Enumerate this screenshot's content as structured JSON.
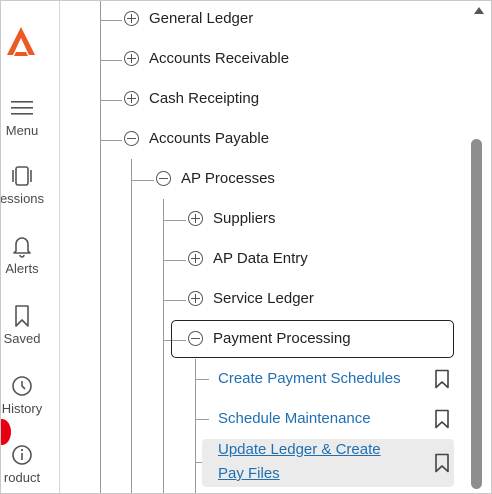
{
  "rail": {
    "items": [
      {
        "name": "menu",
        "label": "Menu"
      },
      {
        "name": "sessions",
        "label": "essions"
      },
      {
        "name": "alerts",
        "label": "Alerts"
      },
      {
        "name": "saved",
        "label": "Saved"
      },
      {
        "name": "history",
        "label": "History"
      },
      {
        "name": "product",
        "label": "roduct"
      }
    ],
    "brand_color": "#ec5a24"
  },
  "tree": {
    "level1": [
      {
        "label": "General Ledger",
        "state": "collapsed"
      },
      {
        "label": "Accounts Receivable",
        "state": "collapsed"
      },
      {
        "label": "Cash Receipting",
        "state": "collapsed"
      },
      {
        "label": "Accounts Payable",
        "state": "expanded"
      }
    ],
    "level2": [
      {
        "label": "AP Processes",
        "state": "expanded"
      }
    ],
    "level3": [
      {
        "label": "Suppliers",
        "state": "collapsed"
      },
      {
        "label": "AP Data Entry",
        "state": "collapsed"
      },
      {
        "label": "Service Ledger",
        "state": "collapsed"
      },
      {
        "label": "Payment Processing",
        "state": "expanded"
      }
    ],
    "links": [
      {
        "line1": "Create Payment Schedules"
      },
      {
        "line1": "Schedule Maintenance"
      },
      {
        "line1": "Update Ledger & Create",
        "line2": "Pay Files"
      }
    ],
    "link_color": "#1f6fb2"
  }
}
